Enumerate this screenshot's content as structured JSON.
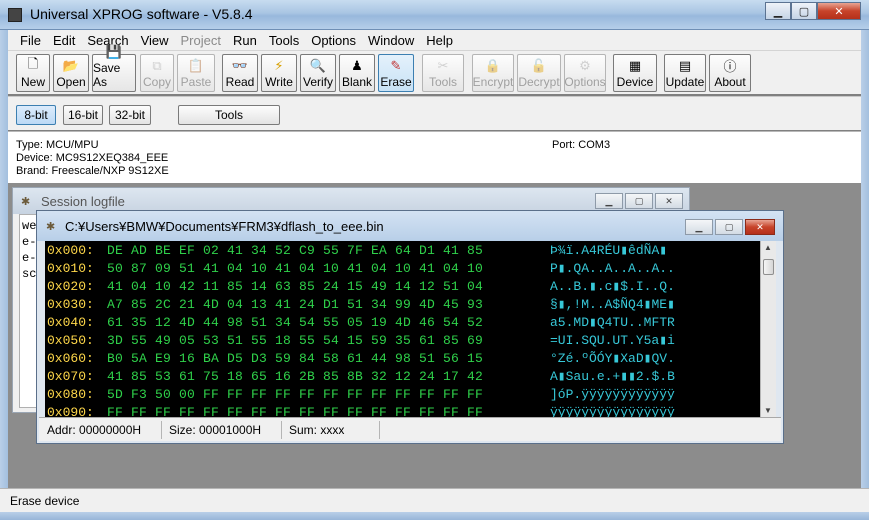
{
  "window": {
    "title": "Universal XPROG software - V5.8.4",
    "min": "0",
    "max": "1",
    "close": "r"
  },
  "menu": [
    "File",
    "Edit",
    "Search",
    "View",
    "Project",
    "Run",
    "Tools",
    "Options",
    "Window",
    "Help"
  ],
  "menu_disabled": [
    "Project"
  ],
  "toolbar": {
    "new": "New",
    "open": "Open",
    "save_as": "Save As",
    "copy": "Copy",
    "paste": "Paste",
    "read": "Read",
    "write": "Write",
    "verify": "Verify",
    "blank": "Blank",
    "erase": "Erase",
    "tools": "Tools",
    "encrypt": "Encrypt",
    "decrypt": "Decrypt",
    "options": "Options",
    "device": "Device",
    "update": "Update",
    "about": "About"
  },
  "subbar": {
    "b8": "8-bit",
    "b16": "16-bit",
    "b32": "32-bit",
    "tools": "Tools"
  },
  "info": {
    "type": "Type: MCU/MPU",
    "device": "Device: MC9S12XEQ384_EEE",
    "brand": "Brand: Freescale/NXP 9S12XE",
    "port": "Port: COM3"
  },
  "logwin": {
    "title": "Session logfile",
    "lines": [
      "we",
      "e-",
      "e-",
      "sc"
    ]
  },
  "hexwin": {
    "title": "C:¥Users¥BMW¥Documents¥FRM3¥dflash_to_eee.bin",
    "rows": [
      {
        "addr": "0x000:",
        "bytes": "DE AD BE EF 02 41 34 52 C9 55 7F EA 64 D1 41 85",
        "ascii": "Þ­¾ï.A4RÉU▮êdÑA▮"
      },
      {
        "addr": "0x010:",
        "bytes": "50 87 09 51 41 04 10 41 04 10 41 04 10 41 04 10",
        "ascii": "P▮.QA..A..A..A.."
      },
      {
        "addr": "0x020:",
        "bytes": "41 04 10 42 11 85 14 63 85 24 15 49 14 12 51 04",
        "ascii": "A..B.▮.c▮$.I..Q."
      },
      {
        "addr": "0x030:",
        "bytes": "A7 85 2C 21 4D 04 13 41 24 D1 51 34 99 4D 45 93",
        "ascii": "§▮,!M..A$ÑQ4▮ME▮"
      },
      {
        "addr": "0x040:",
        "bytes": "61 35 12 4D 44 98 51 34 54 55 05 19 4D 46 54 52",
        "ascii": "a5.MD▮Q4TU..MFTR"
      },
      {
        "addr": "0x050:",
        "bytes": "3D 55 49 05 53 51 55 18 55 54 15 59 35 61 85 69",
        "ascii": "=UI.SQU.UT.Y5a▮i"
      },
      {
        "addr": "0x060:",
        "bytes": "B0 5A E9 16 BA D5 D3 59 84 58 61 44 98 51 56 15",
        "ascii": "°Zé.ºÕÓY▮XaD▮QV."
      },
      {
        "addr": "0x070:",
        "bytes": "41 85 53 61 75 18 65 16 2B 85 8B 32 12 24 17 42",
        "ascii": "A▮Sau.e.+▮▮2.$.B"
      },
      {
        "addr": "0x080:",
        "bytes": "5D F3 50 00 FF FF FF FF FF FF FF FF FF FF FF FF",
        "ascii": "]óP.ÿÿÿÿÿÿÿÿÿÿÿÿ"
      },
      {
        "addr": "0x090:",
        "bytes": "FF FF FF FF FF FF FF FF FF FF FF FF FF FF FF FF",
        "ascii": "ÿÿÿÿÿÿÿÿÿÿÿÿÿÿÿÿ"
      }
    ],
    "status": {
      "addr": "Addr: 00000000H",
      "size": "Size: 00001000H",
      "sum": "Sum: xxxx"
    }
  },
  "statusbar": {
    "text": "Erase device"
  },
  "colors": {
    "hex_bg": "#000000",
    "addr": "#ffd84a",
    "bytes": "#2fd14a",
    "ascii": "#37c8d8"
  }
}
